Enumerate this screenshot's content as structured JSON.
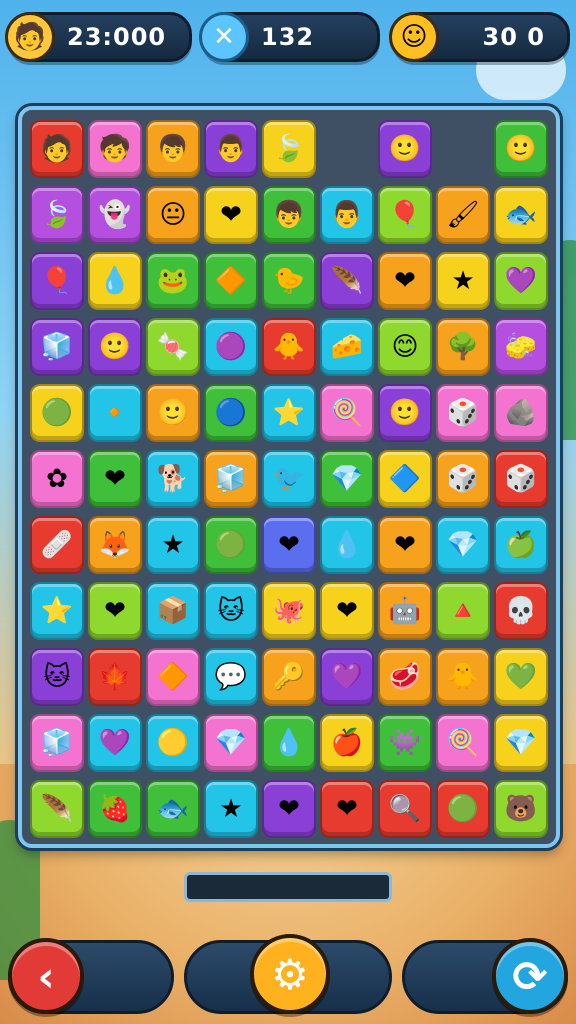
{
  "hud": {
    "coins": {
      "icon": "avatar-icon",
      "glyph": "🧑",
      "value": "23:000"
    },
    "moves": {
      "icon": "close-x-icon",
      "glyph": "✕",
      "value": "132"
    },
    "score": {
      "icon": "coin-icon",
      "glyph": "☺",
      "value": "30 0"
    }
  },
  "progress": {
    "fraction": 0.0
  },
  "buttons": {
    "back": {
      "icon": "back-arrow-icon",
      "glyph": "‹"
    },
    "settings": {
      "icon": "gear-icon",
      "glyph": "⚙"
    },
    "refresh": {
      "icon": "refresh-icon",
      "glyph": "⟳"
    }
  },
  "board": {
    "rows": [
      [
        [
          "face",
          "#e63b2e",
          "🧑"
        ],
        [
          "face",
          "#f472d0",
          "🧒"
        ],
        [
          "face",
          "#f7a21c",
          "👦"
        ],
        [
          "face",
          "#8a3fd6",
          "👨"
        ],
        [
          "leaf",
          "#f6d21c",
          "🍃"
        ],
        [
          "empty",
          "",
          ""
        ],
        [
          "smile",
          "#8a3fd6",
          "🙂"
        ],
        [
          "empty",
          "",
          ""
        ],
        [
          "smile",
          "#3fbf3a",
          "🙂"
        ]
      ],
      [
        [
          "leaf",
          "#b44fe0",
          "🍃"
        ],
        [
          "ghost",
          "#b44fe0",
          "👻"
        ],
        [
          "blob",
          "#f7a21c",
          "😐"
        ],
        [
          "heart",
          "#f6d21c",
          "❤"
        ],
        [
          "face",
          "#3fbf3a",
          "👦"
        ],
        [
          "face",
          "#22c4e8",
          "👨"
        ],
        [
          "balloon",
          "#8fd82e",
          "🎈"
        ],
        [
          "brush",
          "#f7a21c",
          "🖌"
        ],
        [
          "fish",
          "#f6d21c",
          "🐟"
        ]
      ],
      [
        [
          "balloon",
          "#8a3fd6",
          "🎈"
        ],
        [
          "drop",
          "#f6d21c",
          "💧"
        ],
        [
          "frog",
          "#3fbf3a",
          "🐸"
        ],
        [
          "shard",
          "#3fbf3a",
          "🔶"
        ],
        [
          "duck",
          "#3fbf3a",
          "🐤"
        ],
        [
          "feather",
          "#8a3fd6",
          "🪶"
        ],
        [
          "heart",
          "#f7a21c",
          "❤"
        ],
        [
          "star",
          "#f6d21c",
          "★"
        ],
        [
          "heart",
          "#8fd82e",
          "💜"
        ]
      ],
      [
        [
          "cube",
          "#8a3fd6",
          "🧊"
        ],
        [
          "face",
          "#8a3fd6",
          "🙂"
        ],
        [
          "candy",
          "#8fd82e",
          "🍬"
        ],
        [
          "blob",
          "#22c4e8",
          "🟣"
        ],
        [
          "chick",
          "#e63b2e",
          "🐥"
        ],
        [
          "cheese",
          "#22c4e8",
          "🧀"
        ],
        [
          "face",
          "#8fd82e",
          "😊"
        ],
        [
          "tree",
          "#f7a21c",
          "🌳"
        ],
        [
          "eraser",
          "#b44fe0",
          "🧽"
        ]
      ],
      [
        [
          "orb",
          "#f6d21c",
          "🟢"
        ],
        [
          "gem",
          "#22c4e8",
          "🔸"
        ],
        [
          "face",
          "#f7a21c",
          "🙂"
        ],
        [
          "blob",
          "#3fbf3a",
          "🔵"
        ],
        [
          "star",
          "#22c4e8",
          "⭐"
        ],
        [
          "lolly",
          "#f472d0",
          "🍭"
        ],
        [
          "smile",
          "#8a3fd6",
          "🙂"
        ],
        [
          "dice",
          "#f472d0",
          "🎲"
        ],
        [
          "rock",
          "#f472d0",
          "🪨"
        ]
      ],
      [
        [
          "flower",
          "#f472d0",
          "✿"
        ],
        [
          "heart",
          "#3fbf3a",
          "❤"
        ],
        [
          "dog",
          "#22c4e8",
          "🐕"
        ],
        [
          "cube",
          "#f7a21c",
          "🧊"
        ],
        [
          "bird",
          "#22c4e8",
          "🐦"
        ],
        [
          "gem",
          "#3fbf3a",
          "💎"
        ],
        [
          "ice",
          "#f6d21c",
          "🔷"
        ],
        [
          "dice",
          "#f7a21c",
          "🎲"
        ],
        [
          "dice",
          "#e63b2e",
          "🎲"
        ]
      ],
      [
        [
          "eraser",
          "#e63b2e",
          "🩹"
        ],
        [
          "fox",
          "#f7a21c",
          "🦊"
        ],
        [
          "star",
          "#22c4e8",
          "★"
        ],
        [
          "orb",
          "#3fbf3a",
          "🟢"
        ],
        [
          "heart",
          "#5b6ef0",
          "❤"
        ],
        [
          "drop",
          "#22c4e8",
          "💧"
        ],
        [
          "heart",
          "#f7a21c",
          "❤"
        ],
        [
          "gem",
          "#22c4e8",
          "💎"
        ],
        [
          "apple",
          "#22c4e8",
          "🍏"
        ]
      ],
      [
        [
          "star",
          "#22c4e8",
          "⭐"
        ],
        [
          "heart",
          "#8fd82e",
          "❤"
        ],
        [
          "box",
          "#22c4e8",
          "📦"
        ],
        [
          "fox",
          "#22c4e8",
          "🐱"
        ],
        [
          "ghost",
          "#f6d21c",
          "🐙"
        ],
        [
          "heart",
          "#f6d21c",
          "❤"
        ],
        [
          "robot",
          "#f7a21c",
          "🤖"
        ],
        [
          "triangle",
          "#8fd82e",
          "🔺"
        ],
        [
          "skull",
          "#e63b2e",
          "💀"
        ]
      ],
      [
        [
          "face",
          "#8a3fd6",
          "🐱"
        ],
        [
          "leaf",
          "#e63b2e",
          "🍁"
        ],
        [
          "shield",
          "#f472d0",
          "🔶"
        ],
        [
          "bubble",
          "#22c4e8",
          "💬"
        ],
        [
          "key",
          "#f7a21c",
          "🔑"
        ],
        [
          "heart",
          "#8a3fd6",
          "💜"
        ],
        [
          "drop",
          "#f7a21c",
          "🥩"
        ],
        [
          "ghost",
          "#f7a21c",
          "🐥"
        ],
        [
          "heart",
          "#f6d21c",
          "💚"
        ]
      ],
      [
        [
          "cube",
          "#f472d0",
          "🧊"
        ],
        [
          "heart",
          "#22c4e8",
          "💜"
        ],
        [
          "shield",
          "#22c4e8",
          "🟡"
        ],
        [
          "gem",
          "#f472d0",
          "💎"
        ],
        [
          "drop",
          "#3fbf3a",
          "💧"
        ],
        [
          "apple",
          "#f6d21c",
          "🍎"
        ],
        [
          "blob",
          "#3fbf3a",
          "👾"
        ],
        [
          "lolly",
          "#f472d0",
          "🍭"
        ],
        [
          "gem",
          "#f6d21c",
          "💎"
        ]
      ],
      [
        [
          "feather",
          "#8fd82e",
          "🪶"
        ],
        [
          "heart",
          "#3fbf3a",
          "🍓"
        ],
        [
          "fish",
          "#3fbf3a",
          "🐟"
        ],
        [
          "star",
          "#22c4e8",
          "★"
        ],
        [
          "heart",
          "#8a3fd6",
          "❤"
        ],
        [
          "heart",
          "#e63b2e",
          "❤"
        ],
        [
          "search",
          "#e63b2e",
          "🔍"
        ],
        [
          "orb",
          "#e63b2e",
          "🟢"
        ],
        [
          "face",
          "#8fd82e",
          "🐻"
        ]
      ]
    ]
  }
}
